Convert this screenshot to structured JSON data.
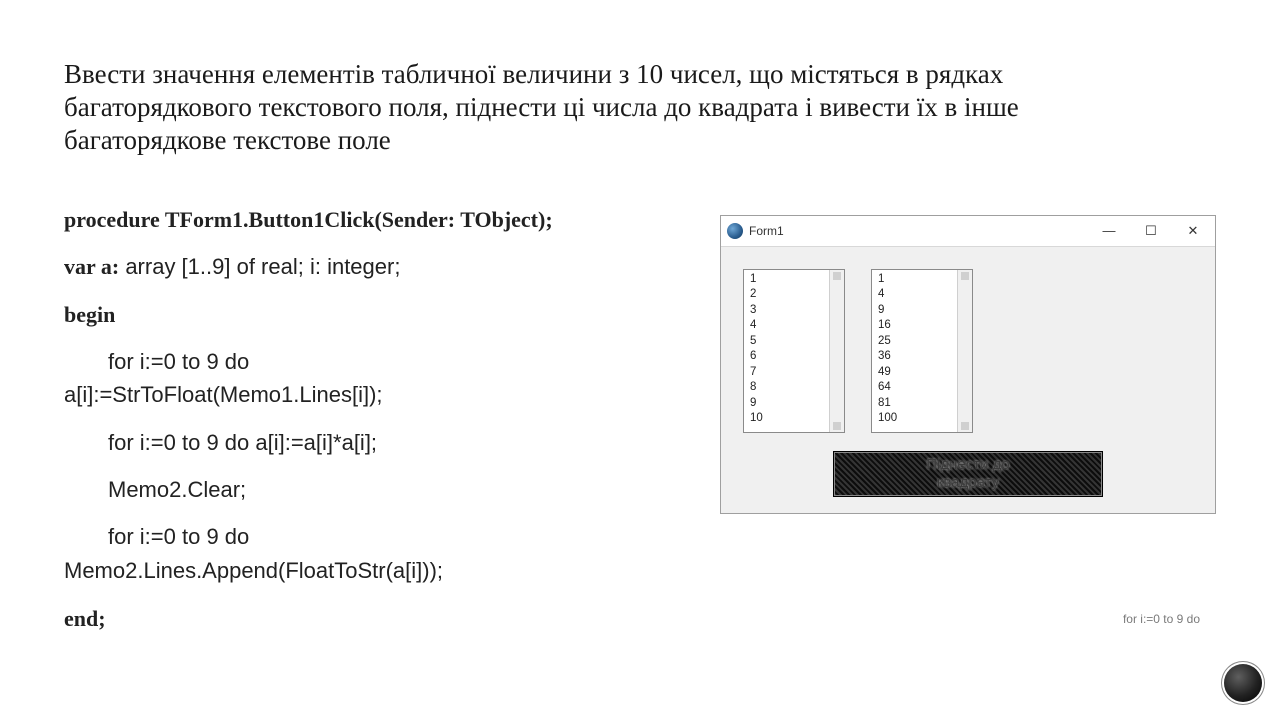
{
  "title": "Ввести значення елементів табличної величини з 10 чисел, що містяться в рядках багаторядкового текстового поля, піднести ці числа до квадрата і вивести їх в інше багаторядкове текстове поле",
  "code": {
    "proc": "procedure TForm1.Button1Click(Sender: TObject);",
    "var_kw": "var a:",
    "var_rest": " array [1..9] of real; i: integer;",
    "begin": "begin",
    "l1a": "for i:=0 to 9 do",
    "l1b": "a[i]:=StrToFloat(Memo1.Lines[i]);",
    "l2": "for i:=0 to 9 do a[i]:=a[i]*a[i];",
    "l3": "Memo2.Clear;",
    "l4a": "for i:=0 to 9 do",
    "l4b": "Memo2.Lines.Append(FloatToStr(a[i]));",
    "end": "end;"
  },
  "window": {
    "title": "Form1",
    "min": "—",
    "max": "☐",
    "close": "✕",
    "memo1": [
      "1",
      "2",
      "3",
      "4",
      "5",
      "6",
      "7",
      "8",
      "9",
      "10"
    ],
    "memo2": [
      "1",
      "4",
      "9",
      "16",
      "25",
      "36",
      "49",
      "64",
      "81",
      "100"
    ],
    "button": "Піднести до\nквадрату"
  },
  "footnote": "for i:=0 to 9 do"
}
